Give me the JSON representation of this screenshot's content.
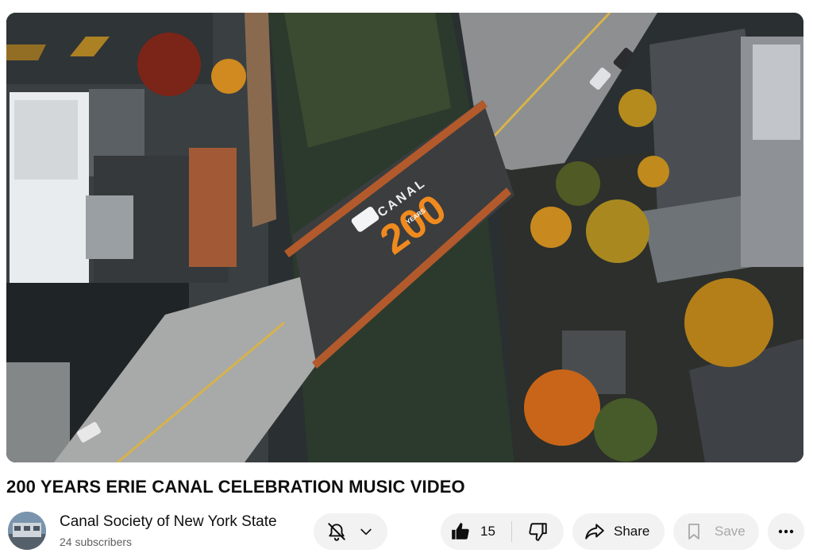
{
  "video": {
    "overlay_word": "CANAL",
    "overlay_number": "200",
    "overlay_years": "YEARS",
    "title": "200 YEARS ERIE CANAL CELEBRATION MUSIC VIDEO"
  },
  "channel": {
    "name": "Canal Society of New York State",
    "subscribers": "24 subscribers"
  },
  "actions": {
    "like_count": "15",
    "share_label": "Share",
    "save_label": "Save"
  },
  "icons": {
    "notify": "bell-slash-icon",
    "dropdown": "chevron-down-icon",
    "like": "thumbs-up-icon",
    "dislike": "thumbs-down-icon",
    "share": "share-arrow-icon",
    "save": "bookmark-icon",
    "more": "more-horizontal-icon"
  }
}
